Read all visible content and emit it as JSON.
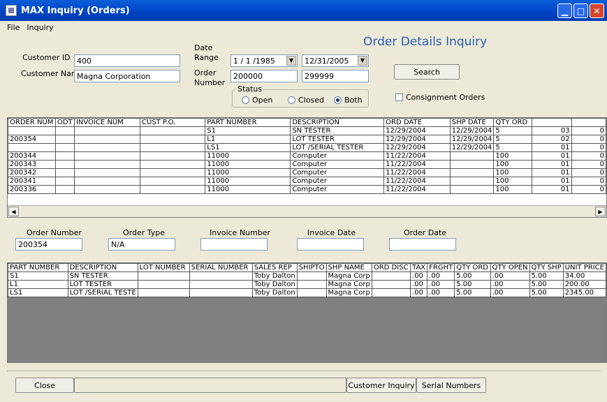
{
  "window": {
    "title": "MAX Inquiry (Orders)"
  },
  "menu": [
    "File",
    "Inquiry"
  ],
  "heading": "Order Details Inquiry",
  "filters": {
    "customer_id_label": "Customer ID",
    "customer_id": "400",
    "customer_name_label": "Customer Name",
    "customer_name": "Magna Corporation",
    "date_range_label_1": "Date",
    "date_range_label_2": "Range",
    "date_from": "1 / 1 /1985",
    "date_to": "12/31/2005",
    "order_number_label_1": "Order",
    "order_number_label_2": "Number",
    "order_from": "200000",
    "order_to": "299999",
    "status_label": "Status",
    "status_options": [
      "Open",
      "Closed",
      "Both"
    ],
    "status_selected": "Both",
    "search_button": "Search",
    "consignment_label": "Consignment Orders"
  },
  "orders": {
    "columns": [
      "ORDER NUM",
      "ODT",
      "INVOICE NUM",
      "CUST P.O.",
      "PART NUMBER",
      "DESCRIPTION",
      "ORD DATE",
      "SHP DATE",
      "QTY ORD",
      "",
      ""
    ],
    "rows": [
      [
        "",
        "",
        "",
        "",
        "S1",
        "SN TESTER",
        "12/29/2004",
        "12/29/2004",
        "5",
        "03",
        "0"
      ],
      [
        "200354",
        "",
        "",
        "",
        "L1",
        "LOT TESTER",
        "12/29/2004",
        "12/29/2004",
        "5",
        "02",
        "0"
      ],
      [
        "",
        "",
        "",
        "",
        "LS1",
        "LOT /SERIAL TESTER",
        "12/29/2004",
        "12/29/2004",
        "5",
        "01",
        "0"
      ],
      [
        "200344",
        "",
        "",
        "",
        "11000",
        "Computer",
        "11/22/2004",
        "",
        "100",
        "01",
        "0"
      ],
      [
        "200343",
        "",
        "",
        "",
        "11000",
        "Computer",
        "11/22/2004",
        "",
        "100",
        "01",
        "0"
      ],
      [
        "200342",
        "",
        "",
        "",
        "11000",
        "Computer",
        "11/22/2004",
        "",
        "100",
        "01",
        "0"
      ],
      [
        "200341",
        "",
        "",
        "",
        "11000",
        "Computer",
        "11/22/2004",
        "",
        "100",
        "01",
        "0"
      ],
      [
        "200336",
        "",
        "",
        "",
        "11000",
        "Computer",
        "11/22/2004",
        "",
        "100",
        "01",
        "0"
      ]
    ]
  },
  "detail": {
    "order_number_label": "Order Number",
    "order_number": "200354",
    "order_type_label": "Order Type",
    "order_type": "N/A",
    "invoice_number_label": "Invoice Number",
    "invoice_number": "",
    "invoice_date_label": "Invoice Date",
    "invoice_date": "",
    "order_date_label": "Order Date",
    "order_date": ""
  },
  "lines": {
    "columns": [
      "PART NUMBER",
      "DESCRIPTION",
      "LOT NUMBER",
      "SERIAL NUMBER",
      "SALES REP",
      "SHIPTO",
      "SHP NAME",
      "ORD DISC",
      "TAX",
      "FRGHT",
      "QTY ORD",
      "QTY OPEN",
      "QTY SHP",
      "UNIT PRICE"
    ],
    "rows": [
      [
        "S1",
        "SN TESTER",
        "",
        "",
        "Toby Dalton",
        "",
        "Magna Corp",
        "",
        ".00",
        ".00",
        "5.00",
        ".00",
        "5.00",
        "34.00"
      ],
      [
        "L1",
        "LOT TESTER",
        "",
        "",
        "Toby Dalton",
        "",
        "Magna Corp",
        "",
        ".00",
        ".00",
        "5.00",
        ".00",
        "5.00",
        "200.00"
      ],
      [
        "LS1",
        "LOT /SERIAL TESTE",
        "",
        "",
        "Toby Dalton",
        "",
        "Magna Corp",
        "",
        ".00",
        ".00",
        "5.00",
        ".00",
        "5.00",
        "2345.00"
      ]
    ]
  },
  "footer": {
    "close_button": "Close",
    "customer_inquiry_button": "Customer Inquiry",
    "serial_numbers_button": "Serial Numbers"
  }
}
